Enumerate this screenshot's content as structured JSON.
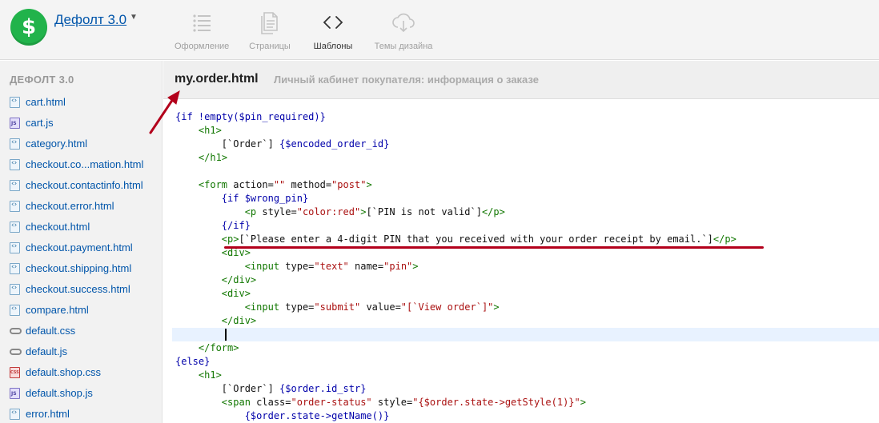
{
  "app": {
    "title": "Дефолт 3.0",
    "logo_glyph": "$",
    "logo_color": "#21b34b"
  },
  "nav": {
    "tabs": [
      {
        "label": "Оформление",
        "icon": "list-icon",
        "active": false
      },
      {
        "label": "Страницы",
        "icon": "pages-icon",
        "active": false
      },
      {
        "label": "Шаблоны",
        "icon": "code-brackets-icon",
        "active": true
      },
      {
        "label": "Темы дизайна",
        "icon": "cloud-download-icon",
        "active": false
      }
    ]
  },
  "sidebar": {
    "heading": "ДЕФОЛТ 3.0",
    "files": [
      {
        "name": "cart.html",
        "type": "html"
      },
      {
        "name": "cart.js",
        "type": "js"
      },
      {
        "name": "category.html",
        "type": "html"
      },
      {
        "name": "checkout.co...mation.html",
        "type": "html"
      },
      {
        "name": "checkout.contactinfo.html",
        "type": "html"
      },
      {
        "name": "checkout.error.html",
        "type": "html"
      },
      {
        "name": "checkout.html",
        "type": "html"
      },
      {
        "name": "checkout.payment.html",
        "type": "html"
      },
      {
        "name": "checkout.shipping.html",
        "type": "html"
      },
      {
        "name": "checkout.success.html",
        "type": "html"
      },
      {
        "name": "compare.html",
        "type": "html"
      },
      {
        "name": "default.css",
        "type": "css"
      },
      {
        "name": "default.js",
        "type": "css"
      },
      {
        "name": "default.shop.css",
        "type": "shopcss"
      },
      {
        "name": "default.shop.js",
        "type": "js"
      },
      {
        "name": "error.html",
        "type": "html"
      }
    ]
  },
  "editor": {
    "filename": "my.order.html",
    "description": "Личный кабинет покупателя: информация о заказе",
    "lines": [
      "{if !empty($pin_required)}",
      "    <h1>",
      "        [`Order`] {$encoded_order_id}",
      "    </h1>",
      "",
      "    <form action=\"\" method=\"post\">",
      "        {if $wrong_pin}",
      "            <p style=\"color:red\">[`PIN is not valid`]</p>",
      "        {/if}",
      "        <p>[`Please enter a 4-digit PIN that you received with your order receipt by email.`]</p>",
      "        <div>",
      "            <input type=\"text\" name=\"pin\">",
      "        </div>",
      "        <div>",
      "            <input type=\"submit\" value=\"[`View order`]\">",
      "        </div>",
      "        ",
      "    </form>",
      "{else}",
      "    <h1>",
      "        [`Order`] {$order.id_str}",
      "        <span class=\"order-status\" style=\"{$order.state->getStyle(1)}\">",
      "            {$order.state->getName()}"
    ],
    "current_line": 16
  },
  "annotation": {
    "color": "#b3001b"
  }
}
